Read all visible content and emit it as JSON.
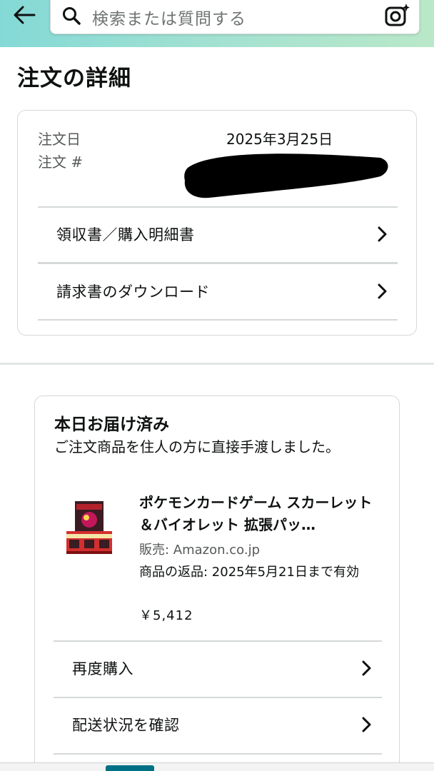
{
  "header": {
    "search_placeholder": "検索または質問する",
    "colors": {
      "gradient_start": "#84d9d6",
      "gradient_end": "#b9e8c8"
    }
  },
  "page": {
    "title": "注文の詳細"
  },
  "order": {
    "date_label": "注文日",
    "date_value": "2025年3月25日",
    "number_label": "注文 #",
    "rows": [
      {
        "label": "領収書／購入明細書"
      },
      {
        "label": "請求書のダウンロード"
      }
    ]
  },
  "delivery": {
    "status": "本日お届け済み",
    "message": "ご注文商品を住人の方に直接手渡しました。",
    "product": {
      "title": "ポケモンカードゲーム スカーレット＆バイオレット 拡張パッ…",
      "seller": "販売: Amazon.co.jp",
      "return_policy": "商品の返品: 2025年5月21日まで有効",
      "price": "￥5,412"
    },
    "rows": [
      {
        "label": "再度購入"
      },
      {
        "label": "配送状況を確認"
      }
    ]
  },
  "icons": {
    "back": "arrow-left-icon",
    "search": "search-icon",
    "camera": "camera-icon",
    "chevron": "chevron-right-icon"
  }
}
